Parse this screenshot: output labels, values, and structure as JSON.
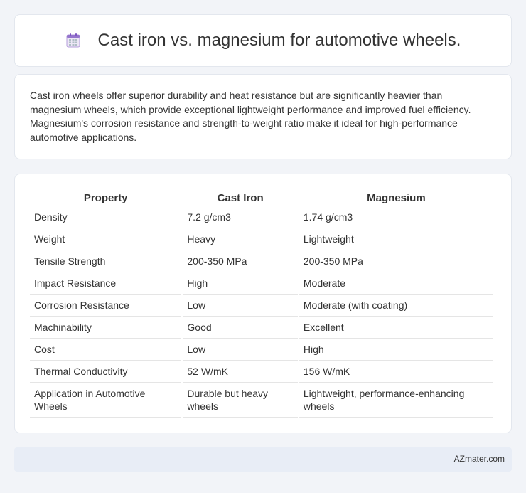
{
  "title": "Cast iron vs. magnesium for automotive wheels.",
  "summary": "Cast iron wheels offer superior durability and heat resistance but are significantly heavier than magnesium wheels, which provide exceptional lightweight performance and improved fuel efficiency. Magnesium's corrosion resistance and strength-to-weight ratio make it ideal for high-performance automotive applications.",
  "table": {
    "headers": [
      "Property",
      "Cast Iron",
      "Magnesium"
    ],
    "rows": [
      [
        "Density",
        "7.2 g/cm3",
        "1.74 g/cm3"
      ],
      [
        "Weight",
        "Heavy",
        "Lightweight"
      ],
      [
        "Tensile Strength",
        "200-350 MPa",
        "200-350 MPa"
      ],
      [
        "Impact Resistance",
        "High",
        "Moderate"
      ],
      [
        "Corrosion Resistance",
        "Low",
        "Moderate (with coating)"
      ],
      [
        "Machinability",
        "Good",
        "Excellent"
      ],
      [
        "Cost",
        "Low",
        "High"
      ],
      [
        "Thermal Conductivity",
        "52 W/mK",
        "156 W/mK"
      ],
      [
        "Application in Automotive Wheels",
        "Durable but heavy wheels",
        "Lightweight, performance-enhancing wheels"
      ]
    ]
  },
  "footer": "AZmater.com",
  "icon": "calendar-icon"
}
